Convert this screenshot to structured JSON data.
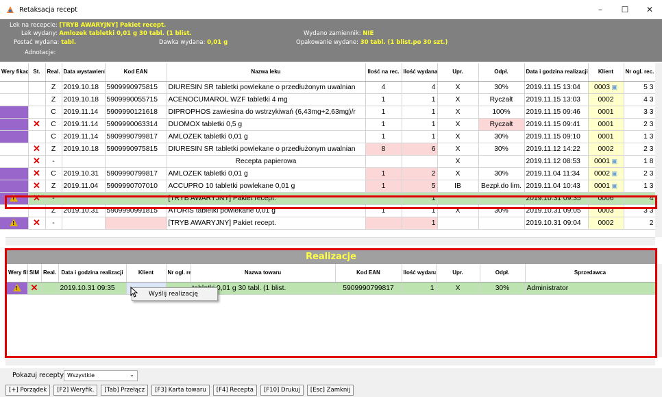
{
  "window": {
    "title": "Retaksacja recept",
    "min": "–",
    "max": "☐",
    "close": "✕"
  },
  "info": {
    "lek_na_recepcie_label": "Lek na recepcie:",
    "lek_na_recepcie": "[TRYB AWARYJNY] Pakiet recept.",
    "lek_wydany_label": "Lek wydany:",
    "lek_wydany": "Amlozek tabletki 0,01 g 30 tabl. (1 blist.",
    "wydano_zamiennik_label": "Wydano zamiennik:",
    "wydano_zamiennik": "NIE",
    "postac_label": "Postać wydana:",
    "postac": "tabl.",
    "dawka_label": "Dawka wydana:",
    "dawka": "0,01 g",
    "opakowanie_label": "Opakowanie wydane:",
    "opakowanie": "30 tabl. (1 blist.po 30 szt.)",
    "adnotacje_label": "Adnotacje:"
  },
  "recepty": {
    "headers": [
      "Wery fikacja",
      "St.",
      "Real.",
      "Data wystawienia",
      "Kod EAN",
      "Nazwa leku",
      "Ilość na rec.",
      "Ilość wydana",
      "Upr.",
      "Odpł.",
      "Data i godzina realizacji",
      "Klient",
      "Nr ogl. rec."
    ],
    "rows": [
      {
        "wer": "",
        "st": "",
        "real": "Z",
        "data": "2019.10.18",
        "ean": "5909990975815",
        "nazwa": "DIURESIN SR tabletki powlekane o przedłużonym uwalnian",
        "ilr": "4",
        "ilw": "4",
        "upr": "X",
        "odpl": "30%",
        "dreal": "2019.11.15 13:04",
        "klient": "0003",
        "nr": "5 3",
        "purple": false,
        "stx": false,
        "bubble": true,
        "pink": false,
        "odplpink": false
      },
      {
        "wer": "",
        "st": "",
        "real": "Z",
        "data": "2019.10.18",
        "ean": "5909990055715",
        "nazwa": "ACENOCUMAROL WZF tabletki 4 mg",
        "ilr": "1",
        "ilw": "1",
        "upr": "X",
        "odpl": "Ryczałt",
        "dreal": "2019.11.15 13:03",
        "klient": "0002",
        "nr": "4 3",
        "purple": false,
        "stx": false,
        "bubble": false,
        "pink": false,
        "odplpink": false
      },
      {
        "wer": "",
        "st": "",
        "real": "C",
        "data": "2019.11.14",
        "ean": "5909990121618",
        "nazwa": "DIPROPHOS zawiesina do wstrzykiwań (6,43mg+2,63mg)/r",
        "ilr": "1",
        "ilw": "1",
        "upr": "X",
        "odpl": "100%",
        "dreal": "2019.11.15 09:46",
        "klient": "0001",
        "nr": "3 3",
        "purple": true,
        "stx": false,
        "bubble": false,
        "pink": false,
        "odplpink": false
      },
      {
        "wer": "",
        "st": "✕",
        "real": "C",
        "data": "2019.11.14",
        "ean": "5909990063314",
        "nazwa": "DUOMOX tabletki 0,5 g",
        "ilr": "1",
        "ilw": "1",
        "upr": "X",
        "odpl": "Ryczałt",
        "dreal": "2019.11.15 09:41",
        "klient": "0001",
        "nr": "2 3",
        "purple": true,
        "stx": true,
        "bubble": false,
        "pink": false,
        "odplpink": true
      },
      {
        "wer": "",
        "st": "",
        "real": "C",
        "data": "2019.11.14",
        "ean": "5909990799817",
        "nazwa": "AMLOZEK tabletki 0,01 g",
        "ilr": "1",
        "ilw": "1",
        "upr": "X",
        "odpl": "30%",
        "dreal": "2019.11.15 09:10",
        "klient": "0001",
        "nr": "1 3",
        "purple": true,
        "stx": false,
        "bubble": false,
        "pink": false,
        "odplpink": false
      },
      {
        "wer": "",
        "st": "✕",
        "real": "Z",
        "data": "2019.10.18",
        "ean": "5909990975815",
        "nazwa": "DIURESIN SR tabletki powlekane o przedłużonym uwalnian",
        "ilr": "8",
        "ilw": "6",
        "upr": "X",
        "odpl": "30%",
        "dreal": "2019.11.12 14:22",
        "klient": "0002",
        "nr": "2 3",
        "purple": false,
        "stx": true,
        "bubble": false,
        "pink": true,
        "odplpink": false
      },
      {
        "wer": "",
        "st": "✕",
        "real": "-",
        "data": "",
        "ean": "",
        "nazwa": "Recepta papierowa",
        "ilr": "",
        "ilw": "",
        "upr": "X",
        "odpl": "",
        "dreal": "2019.11.12 08:53",
        "klient": "0001",
        "nr": "1 8",
        "purple": false,
        "stx": true,
        "bubble": true,
        "pink": false,
        "odplpink": false,
        "center": true
      },
      {
        "wer": "",
        "st": "✕",
        "real": "C",
        "data": "2019.10.31",
        "ean": "5909990799817",
        "nazwa": "AMLOZEK tabletki 0,01 g",
        "ilr": "1",
        "ilw": "2",
        "upr": "X",
        "odpl": "30%",
        "dreal": "2019.11.04 11:34",
        "klient": "0002",
        "nr": "2 3",
        "purple": true,
        "stx": true,
        "bubble": true,
        "pink": true,
        "odplpink": false
      },
      {
        "wer": "",
        "st": "✕",
        "real": "Z",
        "data": "2019.11.04",
        "ean": "5909990707010",
        "nazwa": "ACCUPRO 10 tabletki powlekane 0,01 g",
        "ilr": "1",
        "ilw": "5",
        "upr": "IB",
        "odpl": "Bezpł.do lim.",
        "dreal": "2019.11.04 10:43",
        "klient": "0001",
        "nr": "1 3",
        "purple": true,
        "stx": true,
        "bubble": true,
        "pink": true,
        "odplpink": false
      },
      {
        "wer": "warn",
        "st": "✕",
        "real": "-",
        "data": "",
        "ean": "",
        "nazwa": "[TRYB AWARYJNY] Pakiet recept.",
        "ilr": "",
        "ilw": "1",
        "upr": "",
        "odpl": "",
        "dreal": "2019.10.31 09:35",
        "klient": "0006",
        "nr": "4",
        "purple": false,
        "stx": true,
        "bubble": false,
        "pink": false,
        "odplpink": false,
        "green": true
      },
      {
        "wer": "",
        "st": "",
        "real": "Z",
        "data": "2019.10.31",
        "ean": "5909990991815",
        "nazwa": "ATORIS tabletki powlekane 0,01 g",
        "ilr": "1",
        "ilw": "1",
        "upr": "X",
        "odpl": "30%",
        "dreal": "2019.10.31 09:05",
        "klient": "0003",
        "nr": "3 3",
        "purple": false,
        "stx": false,
        "bubble": false,
        "pink": false,
        "odplpink": false
      },
      {
        "wer": "warn",
        "st": "✕",
        "real": "-",
        "data": "",
        "ean": "",
        "nazwa": "[TRYB AWARYJNY] Pakiet recept.",
        "ilr": "",
        "ilw": "1",
        "upr": "",
        "odpl": "",
        "dreal": "2019.10.31 09:04",
        "klient": "0002",
        "nr": "2",
        "purple": false,
        "stx": true,
        "bubble": false,
        "pink": true,
        "odplpink": false,
        "eanpink": true
      }
    ]
  },
  "realizacje": {
    "title": "Realizacje",
    "headers": [
      "Wery fikacja",
      "SIM",
      "Real.",
      "Data i godzina realizacji",
      "Klient",
      "Nr ogl. rec.",
      "Nazwa towaru",
      "Kod EAN",
      "Ilość wydana",
      "Upr.",
      "Odpł.",
      "Sprzedawca"
    ],
    "rows": [
      {
        "wer": "warn",
        "sim": "✕",
        "real": "",
        "dreal": "2019.10.31 09:35",
        "klient": "",
        "nr": "",
        "nazwa": "tabletki 0,01 g 30 tabl. (1 blist.",
        "ean": "5909990799817",
        "ilw": "1",
        "upr": "X",
        "odpl": "30%",
        "sprzedawca": "Administrator"
      }
    ]
  },
  "context_menu": {
    "item": "Wyślij realizację"
  },
  "filter": {
    "label": "Pokazuj recepty:",
    "value": "Wszystkie"
  },
  "buttons": [
    "[+] Porządek",
    "[F2] Weryfik.",
    "[Tab] Przełącz",
    "[F3] Karta towaru",
    "[F4] Recepta",
    "[F10] Drukuj",
    "[Esc] Zamknij"
  ]
}
